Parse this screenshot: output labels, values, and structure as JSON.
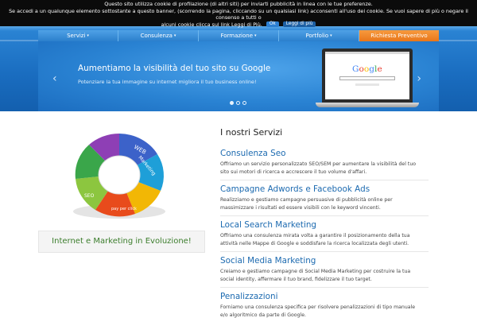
{
  "cookie": {
    "line1": "Questo sito utilizza cookie di profilazione (di altri siti) per inviarti pubblicità in linea con le tue preferenze.",
    "line2": "Se accedi a un qualunque elemento sottostante a questo banner, (scorrendo la pagina, cliccando su un qualsiasi link) acconsenti all'uso dei cookie. Se vuoi sapere di più o negare il consenso a tutti o",
    "line3": "alcuni cookie clicca sul link Leggi di Più.",
    "ok_label": "Ok",
    "more_label": "Leggi di più"
  },
  "nav": {
    "items": [
      "Servizi",
      "Consulenza",
      "Formazione",
      "Portfolio"
    ],
    "cta": "Richiesta Preventivo",
    "caret": "▾"
  },
  "slider": {
    "title": "Aumentiamo la visibilità del tuo sito su Google",
    "subtitle": "Potenziare la tua immagine su internet migliora il tuo business online!",
    "prev": "‹",
    "next": "›",
    "laptop_logo": "Google",
    "slide_count": 3,
    "active_slide": 1
  },
  "left": {
    "caption": "Internet e Marketing in Evoluzione!",
    "donut_labels": [
      "WEB",
      "Marketing",
      "SEO",
      "pay per click"
    ]
  },
  "services": {
    "heading": "I nostri Servizi",
    "items": [
      {
        "title": "Consulenza Seo",
        "desc1": "Offriamo un servizio personalizzato SEO/SEM per aumentare la visibilità del tuo",
        "desc2": "sito sui motori di ricerca e accrescere il tuo volume d'affari."
      },
      {
        "title": "Campagne Adwords e Facebook Ads",
        "desc1": "Realizziamo e gestiamo campagne persuasive di pubblicità online per",
        "desc2": "massimizzare i risultati ed essere visibili con le keyword vincenti."
      },
      {
        "title": "Local Search Marketing",
        "desc1": "Offriamo una consulenza mirata volta a garantire il posizionamento della tua",
        "desc2": "attività nelle Mappe di Google e soddisfare la ricerca localizzata degli utenti."
      },
      {
        "title": "Social Media Marketing",
        "desc1": "Creiamo e gestiamo campagne di Social Media Marketing per costruire la tua",
        "desc2": "social identity, affermare il tuo brand, fidelizzare il tuo target."
      },
      {
        "title": "Penalizzazioni",
        "desc1": "Forniamo una consulenza specifica per risolvere penalizzazioni di tipo manuale",
        "desc2": "e/o algoritmico da parte di Google."
      }
    ]
  },
  "colors": {
    "accent_blue": "#2a83d3",
    "cta_orange": "#e8761a",
    "link_blue": "#1c6ab0",
    "caption_green": "#3b7d2c"
  }
}
